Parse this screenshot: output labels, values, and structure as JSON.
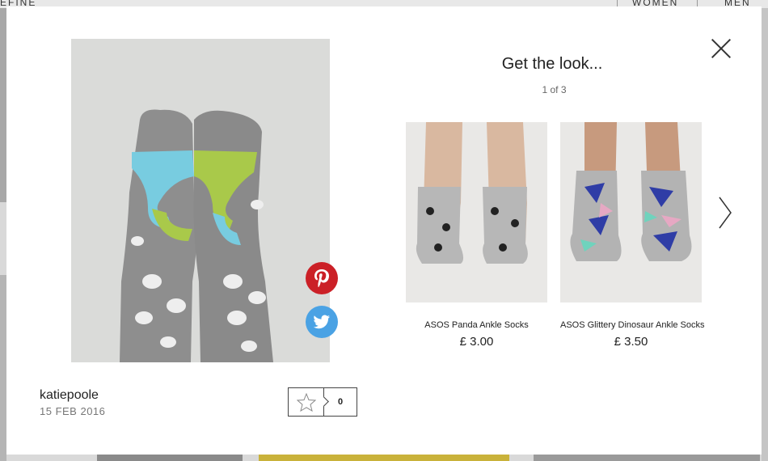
{
  "background_page": {
    "nav_items": [
      "EFINE",
      "WOMEN",
      "MEN"
    ]
  },
  "modal": {
    "close_icon": "close-icon",
    "photo": {
      "description_icon": "socks-photo",
      "share": {
        "pinterest_icon": "pinterest-icon",
        "twitter_icon": "twitter-icon"
      }
    },
    "user": {
      "name": "katiepoole",
      "date": "15 FEB 2016"
    },
    "like": {
      "icon": "star-icon",
      "count": "0"
    },
    "look": {
      "title": "Get the look...",
      "pager": "1 of 3",
      "products": [
        {
          "name": "ASOS Panda Ankle Socks",
          "price": "£ 3.00"
        },
        {
          "name": "ASOS Glittery Dinosaur Ankle Socks",
          "price": "£ 3.50"
        }
      ],
      "next_icon": "chevron-right-icon"
    }
  },
  "colors": {
    "pinterest": "#cb2027",
    "twitter": "#4aa2e4",
    "sock_grey": "#8c8c8c"
  }
}
